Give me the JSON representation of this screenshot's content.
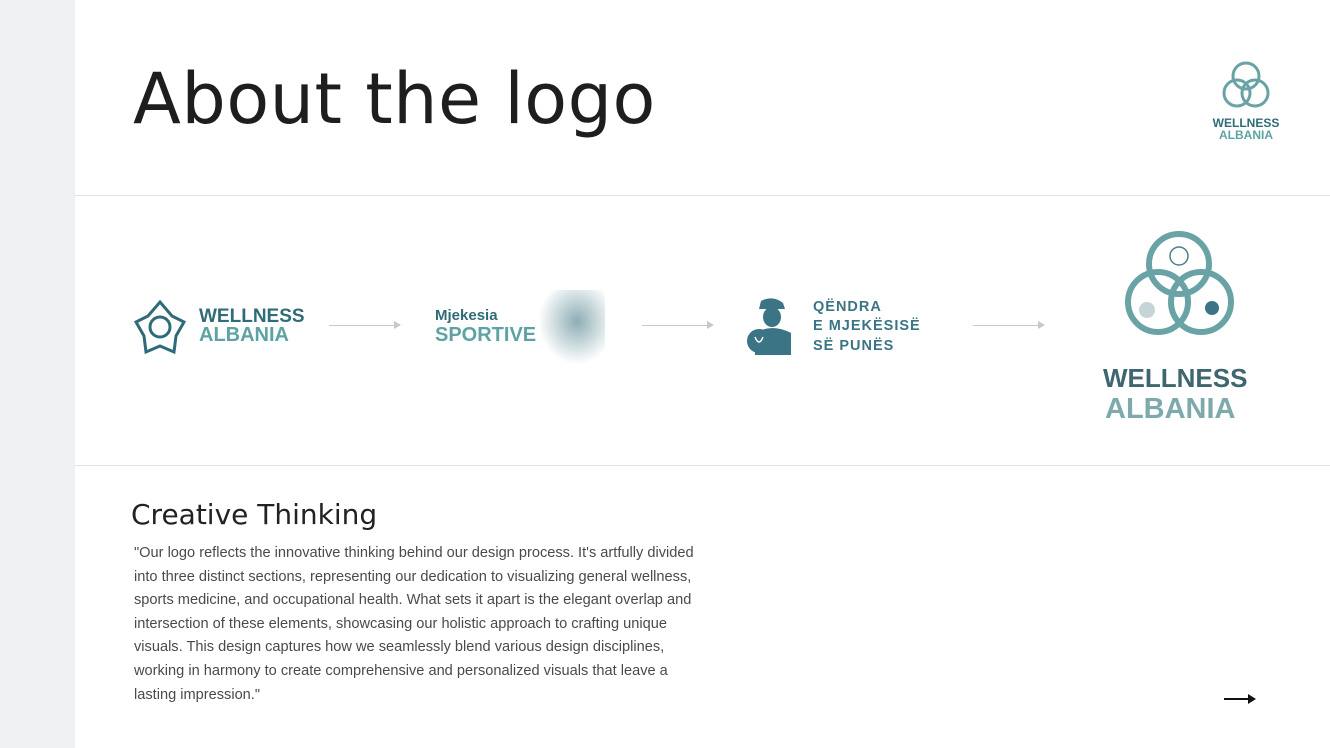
{
  "title": "About the logo",
  "corner_logo": {
    "line1": "WELLNESS",
    "line2": "ALBANIA"
  },
  "logos": [
    {
      "name": "wellness-albania",
      "line1": "WELLNESS",
      "line2": "ALBANIA"
    },
    {
      "name": "mjekesia-sportive",
      "line1": "Mjekesia",
      "line2": "SPORTIVE"
    },
    {
      "name": "qendra-mjekesise-punes",
      "line1": "QËNDRA",
      "line2": "E MJEKËSISË",
      "line3": "SË PUNËS"
    },
    {
      "name": "wellness-albania-final",
      "line1": "WELLNESS",
      "line2": "ALBANIA"
    }
  ],
  "section": {
    "heading": "Creative Thinking",
    "lines": [
      "\"Our logo reflects the innovative thinking behind our design process. It's artfully divided",
      "into three distinct sections, representing our dedication to visualizing general wellness,",
      "sports medicine, and occupational health. What sets it apart is the elegant overlap and",
      "intersection of these elements, showcasing our holistic approach to crafting unique",
      "visuals. This design captures how we seamlessly blend various design disciplines,",
      "working in harmony to create comprehensive and personalized visuals that leave a",
      "lasting impression.\""
    ]
  },
  "colors": {
    "dark_teal": "#2f6b78",
    "light_teal": "#5ea3a4"
  }
}
